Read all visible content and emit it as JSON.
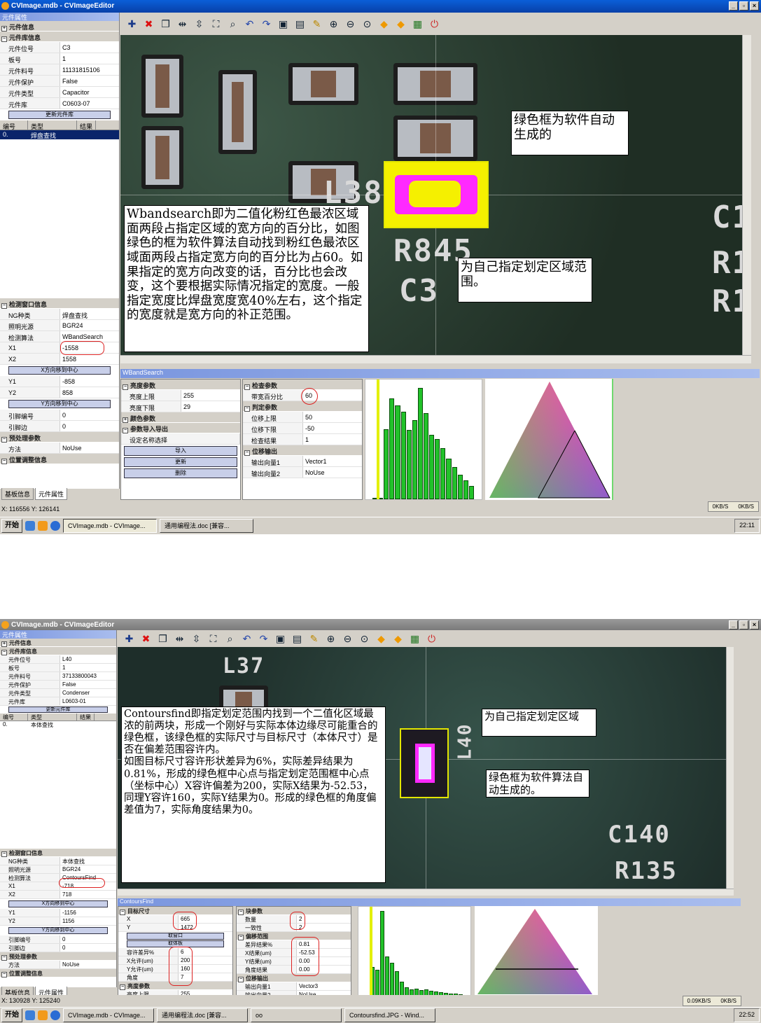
{
  "w1": {
    "title": "CVImage.mdb - CVImageEditor",
    "left_pane_title": "元件属性",
    "sections": {
      "comp_info": "元件信息",
      "lib_info": "元件库信息",
      "detect_info": "检测窗口信息",
      "pre_params": "预处理参数",
      "pos_adjust": "位置调整信息"
    },
    "lib_rows": [
      {
        "k": "元件位号",
        "v": "C3"
      },
      {
        "k": "板号",
        "v": "1"
      },
      {
        "k": "元件料号",
        "v": "11131815106"
      },
      {
        "k": "元件保护",
        "v": "False"
      },
      {
        "k": "元件类型",
        "v": "Capacitor"
      },
      {
        "k": "元件库",
        "v": "C0603-07"
      }
    ],
    "update_btn": "更新元件库",
    "grid_headers": [
      "编号",
      "类型",
      "结果"
    ],
    "grid_row": [
      "0.",
      "焊盘查找",
      ""
    ],
    "detect_rows_a": [
      {
        "k": "NG种类",
        "v": "焊盘查找"
      },
      {
        "k": "照明光源",
        "v": "BGR24"
      },
      {
        "k": "检测算法",
        "v": "WBandSearch"
      },
      {
        "k": "X1",
        "v": "-1558"
      },
      {
        "k": "X2",
        "v": "1558"
      }
    ],
    "x_btn": "X方向移到中心",
    "detect_rows_b": [
      {
        "k": "Y1",
        "v": "-858"
      },
      {
        "k": "Y2",
        "v": "858"
      }
    ],
    "y_btn": "Y方向移到中心",
    "detect_rows_c": [
      {
        "k": "引脚编号",
        "v": "0"
      },
      {
        "k": "引脚边",
        "v": "0"
      }
    ],
    "method_row": {
      "k": "方法",
      "v": "NoUse"
    },
    "tabs": [
      "基板信息",
      "元件属性"
    ],
    "silk": {
      "l38": "L38",
      "r845": "R845",
      "c3": "C3",
      "c1": "C1",
      "r1a": "R1",
      "r1b": "R1"
    },
    "notes": {
      "green_box": "绿色框为软件自动生成的",
      "main": "Wbandsearch即为二值化粉红色最浓区域面两段占指定区域的宽方向的百分比，如图绿色的框为软件算法自动找到粉红色最浓区域面两段占指定宽方向的百分比为占60。如果指定的宽方向改变的话，百分比也会改变，这个要根据实际情况指定的宽度。一般指定宽度比焊盘宽度宽40%左右，这个指定的宽度就是宽方向的补正范围。",
      "user_area": "为自己指定划定区域范围。"
    },
    "subpanel_title": "WBandSearch",
    "p1": {
      "sec_brightness": "亮度参数",
      "rows": [
        {
          "k": "亮度上限",
          "v": "255"
        },
        {
          "k": "亮度下限",
          "v": "29"
        }
      ],
      "sec_color": "颜色参数",
      "sec_io": "参数导入导出",
      "name_row": "设定名称选择",
      "btns": [
        "导入",
        "更新",
        "删除"
      ]
    },
    "p2": {
      "sec_check": "检查参数",
      "band_row": {
        "k": "带宽百分比",
        "v": "60"
      },
      "sec_judge": "判定参数",
      "judge_rows": [
        {
          "k": "位移上限",
          "v": "50"
        },
        {
          "k": "位移下限",
          "v": "-50"
        },
        {
          "k": "检查结果",
          "v": "1"
        }
      ],
      "sec_out": "位移输出",
      "out_rows": [
        {
          "k": "输出向量1",
          "v": "Vector1"
        },
        {
          "k": "输出向量2",
          "v": "NoUse"
        }
      ]
    },
    "histogram": [
      0,
      0,
      96,
      138,
      128,
      120,
      95,
      108,
      152,
      118,
      88,
      82,
      70,
      56,
      44,
      34,
      26,
      18
    ],
    "status_xy": "X: 116556 Y: 126141",
    "net": {
      "down": "0KB/S",
      "up": "0KB/S"
    },
    "taskbar": {
      "start": "开始",
      "items": [
        "CVImage.mdb - CVImage...",
        "通用编程法.doc [兼容..."
      ],
      "clock": "22:11"
    }
  },
  "w2": {
    "title": "CVImage.mdb - CVImageEditor",
    "left_pane_title": "元件属性",
    "sections": {
      "comp_info": "元件信息",
      "lib_info": "元件库信息",
      "detect_info": "检测窗口信息",
      "pre_params": "预处理参数",
      "pos_adjust": "位置调整信息"
    },
    "lib_rows": [
      {
        "k": "元件位号",
        "v": "L40"
      },
      {
        "k": "板号",
        "v": "1"
      },
      {
        "k": "元件料号",
        "v": "37133800043"
      },
      {
        "k": "元件保护",
        "v": "False"
      },
      {
        "k": "元件类型",
        "v": "Condenser"
      },
      {
        "k": "元件库",
        "v": "L0603-01"
      }
    ],
    "update_btn": "更新元件库",
    "grid_headers": [
      "编号",
      "类型",
      "结果"
    ],
    "grid_row": [
      "0.",
      "本体查找",
      ""
    ],
    "detect_rows_a": [
      {
        "k": "NG种类",
        "v": "本体查找"
      },
      {
        "k": "照明光源",
        "v": "BGR24"
      },
      {
        "k": "检测算法",
        "v": "ContoursFind"
      },
      {
        "k": "X1",
        "v": "-718"
      },
      {
        "k": "X2",
        "v": "718"
      }
    ],
    "x_btn": "X方向移到中心",
    "detect_rows_b": [
      {
        "k": "Y1",
        "v": "-1156"
      },
      {
        "k": "Y2",
        "v": "1156"
      }
    ],
    "y_btn": "Y方向移到中心",
    "detect_rows_c": [
      {
        "k": "引脚编号",
        "v": "0"
      },
      {
        "k": "引脚边",
        "v": "0"
      }
    ],
    "method_row": {
      "k": "方法",
      "v": "NoUse"
    },
    "tabs": [
      "基板信息",
      "元件属性"
    ],
    "silk": {
      "c140": "C140",
      "r135": "R135",
      "l40": "L40",
      "l37": "L37"
    },
    "notes": {
      "main": "Contoursfind即指定划定范围内找到一个二值化区域最浓的前两块，形成一个刚好与实际本体边缘尽可能重合的绿色框，该绿色框的实际尺寸与目标尺寸（本体尺寸）是否在偏差范围容许内。\n如图目标尺寸容许形状差异为6%，实际差异结果为0.81%，形成的绿色框中心点与指定划定范围框中心点（坐标中心）X容许偏差为200，实际X结果为-52.53，同理Y容许160，实际Y结果为0。形成的绿色框的角度偏差值为7，实际角度结果为0。",
      "user_area": "为自己指定划定区域",
      "green_box": "绿色框为软件算法自动生成的。"
    },
    "subpanel_title": "ContoursFind",
    "p1": {
      "sec_target": "目标尺寸",
      "target_rows": [
        {
          "k": "X",
          "v": "665"
        },
        {
          "k": "Y",
          "v": "1472"
        }
      ],
      "btns": [
        "取窗口",
        "取体板"
      ],
      "tol_rows": [
        {
          "k": "容许差异%",
          "v": "6"
        },
        {
          "k": "X允许(um)",
          "v": "200"
        },
        {
          "k": "Y允许(um)",
          "v": "160"
        },
        {
          "k": "角度",
          "v": "7"
        }
      ],
      "sec_brightness": "亮度参数",
      "bright_row": {
        "k": "亮度上限",
        "v": "255"
      }
    },
    "p2": {
      "sec_block": "块参数",
      "block_rows": [
        {
          "k": "数量",
          "v": "2"
        },
        {
          "k": "一致性",
          "v": "2"
        }
      ],
      "sec_offset": "偏移范围",
      "result_rows": [
        {
          "k": "差异结果%",
          "v": "0.81"
        },
        {
          "k": "X结果(um)",
          "v": "-52.53"
        },
        {
          "k": "Y结果(um)",
          "v": "0.00"
        },
        {
          "k": "角度结果",
          "v": "0.00"
        }
      ],
      "sec_out": "位移输出",
      "out_rows": [
        {
          "k": "输出向量1",
          "v": "Vector3"
        },
        {
          "k": "输出向量2",
          "v": "NoUse"
        }
      ]
    },
    "histogram": [
      0,
      44,
      40,
      128,
      60,
      50,
      38,
      22,
      14,
      10,
      12,
      9,
      10,
      8,
      7,
      6,
      5,
      4,
      4,
      3
    ],
    "status_xy": "X: 130928 Y: 125240",
    "net": {
      "down": "0.09KB/S",
      "up": "0KB/S"
    },
    "taskbar": {
      "start": "开始",
      "items": [
        "CVImage.mdb - CVImage...",
        "通用编程法.doc [兼容...",
        "oo",
        "Contoursfind.JPG - Wind..."
      ],
      "clock": "22:52"
    }
  },
  "colors": {
    "titlebar": "#0a5fd8",
    "selection": "#0a246a",
    "highlight": "#ff29ff",
    "greenbox": "#e3e600",
    "histbar": "#22c22a",
    "annotation": "#d22222"
  }
}
